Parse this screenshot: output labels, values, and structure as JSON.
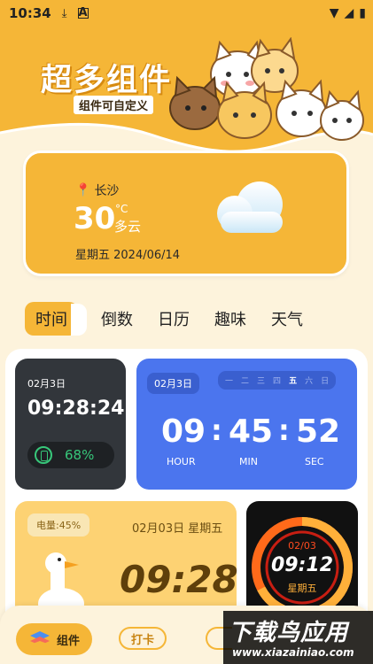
{
  "status_bar": {
    "time": "10:34",
    "download_icon": "download-icon",
    "a_icon": "A"
  },
  "banner": {
    "title": "超多组件",
    "subtitle": "组件可自定义"
  },
  "weather": {
    "city": "长沙",
    "temperature": "30",
    "unit": "°C",
    "condition": "多云",
    "date": "星期五 2024/06/14"
  },
  "tabs": [
    {
      "label": "时间",
      "active": true
    },
    {
      "label": "倒数",
      "active": false
    },
    {
      "label": "日历",
      "active": false
    },
    {
      "label": "趣味",
      "active": false
    },
    {
      "label": "天气",
      "active": false
    }
  ],
  "widgets": {
    "dark_clock": {
      "date": "02月3日",
      "time": "09:28:24",
      "battery": "68%"
    },
    "blue_clock": {
      "date": "02月3日",
      "weekdays": [
        "一",
        "二",
        "三",
        "四",
        "五",
        "六",
        "日"
      ],
      "current_weekday": "五",
      "hour": "09",
      "minute": "45",
      "second": "52",
      "hour_label": "HOUR",
      "minute_label": "MIN",
      "second_label": "SEC"
    },
    "yellow_clock": {
      "battery": "电量:45%",
      "date": "02月03日 星期五",
      "time": "09:28"
    },
    "ring_clock": {
      "date": "02/03",
      "time": "09:12",
      "weekday": "星期五"
    }
  },
  "bottom_nav": {
    "widgets_label": "组件",
    "checkin_label": "打卡"
  },
  "watermark": {
    "title": "下载鸟应用",
    "url": "www.xiazainiao.com"
  },
  "colors": {
    "brand_yellow": "#f5b637",
    "blue_widget": "#4b75ee",
    "dark_widget": "#32363b"
  }
}
